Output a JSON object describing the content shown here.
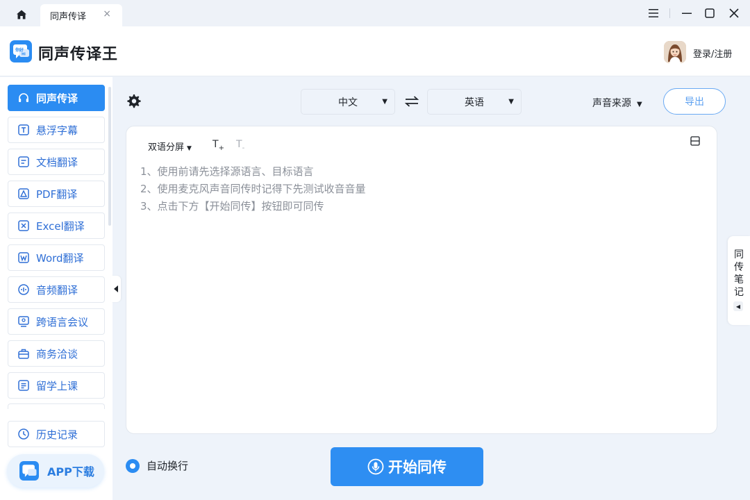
{
  "titlebar": {
    "tab_label": "同声传译",
    "tab_close": "×"
  },
  "header": {
    "app_title": "同声传译王",
    "login_label": "登录/注册"
  },
  "sidebar": {
    "items": [
      {
        "label": "同声传译",
        "icon": "headphones-icon",
        "active": true
      },
      {
        "label": "悬浮字幕",
        "icon": "subtitle-icon"
      },
      {
        "label": "文档翻译",
        "icon": "document-icon"
      },
      {
        "label": "PDF翻译",
        "icon": "pdf-icon"
      },
      {
        "label": "Excel翻译",
        "icon": "excel-icon"
      },
      {
        "label": "Word翻译",
        "icon": "word-icon"
      },
      {
        "label": "音频翻译",
        "icon": "audio-icon"
      },
      {
        "label": "跨语言会议",
        "icon": "meeting-icon"
      },
      {
        "label": "商务洽谈",
        "icon": "business-icon"
      },
      {
        "label": "留学上课",
        "icon": "study-icon"
      }
    ],
    "history_label": "历史记录",
    "app_download_label": "APP下载"
  },
  "toolbar": {
    "source_language": "中文",
    "target_language": "英语",
    "sound_source_label": "声音来源",
    "export_label": "导出"
  },
  "panel": {
    "split_label": "双语分屏",
    "font_increase": "T",
    "font_decrease": "T",
    "hints": [
      "1、使用前请先选择源语言、目标语言",
      "2、使用麦克风声音同传时记得下先测试收音音量",
      "3、点击下方【开始同传】按钮即可同传"
    ]
  },
  "notes_tab_label": "同传笔记",
  "bottom": {
    "auto_wrap_label": "自动换行",
    "start_label": "开始同传"
  },
  "colors": {
    "accent": "#2b8cf2",
    "sidebar_text": "#2f6fd6",
    "background": "#eef3fa"
  }
}
